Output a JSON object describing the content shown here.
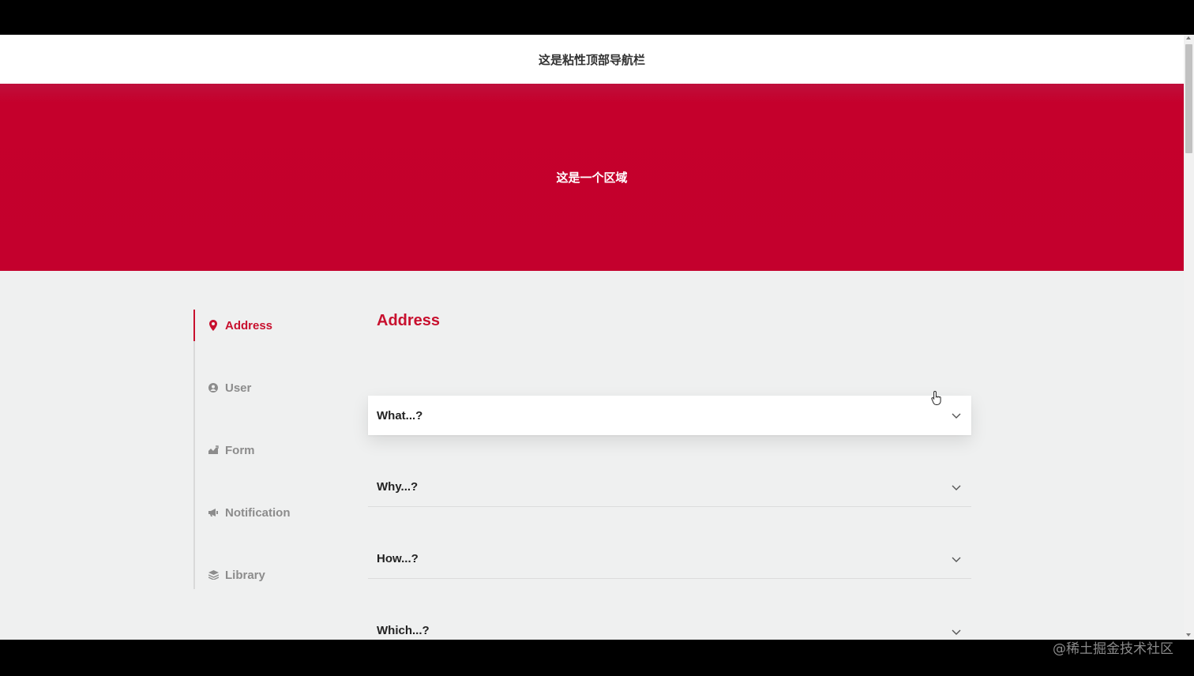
{
  "navbar": {
    "title": "这是粘性顶部导航栏"
  },
  "hero": {
    "text": "这是一个区域"
  },
  "sidenav": {
    "items": [
      {
        "label": "Address",
        "icon": "location-pin-icon",
        "active": true
      },
      {
        "label": "User",
        "icon": "user-circle-icon",
        "active": false
      },
      {
        "label": "Form",
        "icon": "chart-icon",
        "active": false
      },
      {
        "label": "Notification",
        "icon": "megaphone-icon",
        "active": false
      },
      {
        "label": "Library",
        "icon": "layers-icon",
        "active": false
      }
    ]
  },
  "main": {
    "section_title": "Address",
    "accordion": [
      {
        "label": "What...?",
        "expanded": true
      },
      {
        "label": "Why...?",
        "expanded": false
      },
      {
        "label": "How...?",
        "expanded": false
      },
      {
        "label": "Which...?",
        "expanded": false
      }
    ]
  },
  "watermark": "@稀土掘金技术社区",
  "colors": {
    "accent": "#c8102e",
    "hero_bg": "#c4002d",
    "page_bg": "#eff0f0",
    "nav_inactive": "#8c8c8c"
  }
}
